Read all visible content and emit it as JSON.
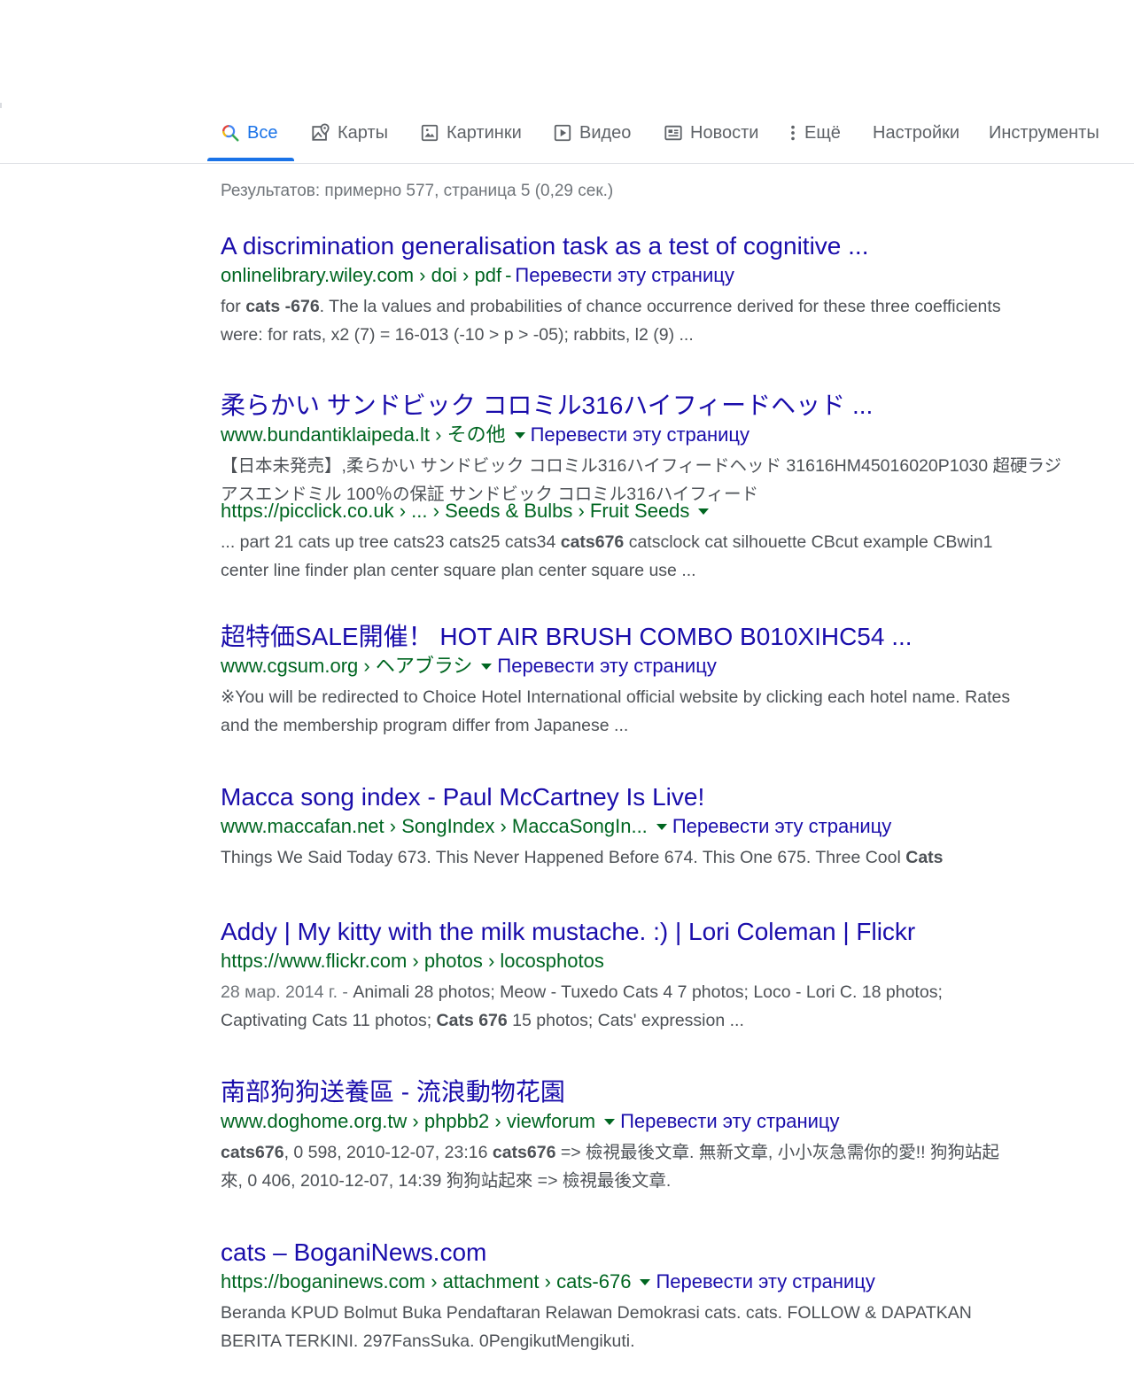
{
  "tabs": [
    {
      "label": "Все",
      "icon": "search-icon",
      "active": true
    },
    {
      "label": "Карты",
      "icon": "map-pin-icon"
    },
    {
      "label": "Картинки",
      "icon": "image-icon"
    },
    {
      "label": "Видео",
      "icon": "video-play-icon"
    },
    {
      "label": "Новости",
      "icon": "newspaper-icon"
    },
    {
      "label": "Ещё",
      "icon": "more-vert-icon"
    },
    {
      "label": "Настройки"
    },
    {
      "label": "Инструменты"
    }
  ],
  "stats": "Результатов: примерно 577, страница 5 (0,29 сек.)",
  "translate_label": "Перевести эту страницу",
  "colors": {
    "link": "#1a0dab",
    "url": "#006621",
    "active_tab": "#1a73e8"
  },
  "results": [
    {
      "title": "A discrimination generalisation task as a test of cognitive ...",
      "url": "onlinelibrary.wiley.com › doi › pdf",
      "snippet_parts": [
        "for ",
        "cats -676",
        ". The la values and probabilities of chance occurrence derived for these three coefficients were: for rats, x2 (7) = 16-013 (-10 > p > -05); rabbits, l2 (9) ..."
      ]
    },
    {
      "title": "柔らかい サンドビック コロミル316ハイフィードヘッド ...",
      "url": "www.bundantiklaipeda.lt › その他",
      "snippet_line1": "【日本未発売】,柔らかい サンドビック コロミル316ハイフィードヘッド 31616HM45016020P1030 超硬ラジ",
      "snippet_line2": "アスエンドミル 100％の保証 サンドビック コロミル316ハイフィード"
    },
    {
      "url": "https://picclick.co.uk › ... › Seeds & Bulbs › Fruit Seeds",
      "snippet_parts": [
        "... part 21 cats up tree cats23 cats25 cats34 ",
        "cats676",
        " catsclock cat silhouette CBcut example CBwin1 center line finder plan center square plan center square use ..."
      ]
    },
    {
      "title": "超特価SALE開催！ HOT AIR BRUSH COMBO B010XIHC54 ...",
      "url": "www.cgsum.org › ヘアブラシ",
      "snippet": "※You will be redirected to Choice Hotel International official website by clicking each hotel name. Rates and the membership program differ from Japanese ..."
    },
    {
      "title": "Macca song index - Paul McCartney Is Live!",
      "url": "www.maccafan.net › SongIndex › MaccaSongIn...",
      "snippet_parts": [
        "Things We Said Today 673. This Never Happened Before 674. This One 675. Three Cool ",
        "Cats"
      ]
    },
    {
      "title": "Addy | My kitty with the milk mustache. :) | Lori Coleman | Flickr",
      "url": "https://www.flickr.com › photos › locosphotos",
      "date": "28 мар. 2014 г. - ",
      "snippet_parts": [
        "Animali 28 photos; Meow - Tuxedo Cats 4 7 photos; Loco - Lori C. 18 photos; Captivating Cats 11 photos; ",
        "Cats 676",
        " 15 photos; Cats' expression ..."
      ]
    },
    {
      "title": "南部狗狗送養區 - 流浪動物花園",
      "url": "www.doghome.org.tw › phpbb2 › viewforum",
      "snippet_parts": [
        "cats676",
        ", 0 598, 2010-12-07, 23:16 ",
        "cats676",
        " => 檢視最後文章. 無新文章, 小小灰急需你的愛!! 狗狗站起來, 0 406, 2010-12-07, 14:39 狗狗站起來 => 檢視最後文章."
      ]
    },
    {
      "title": "cats – BoganiNews.com",
      "url": "https://boganinews.com › attachment › cats-676",
      "snippet": "Beranda KPUD Bolmut Buka Pendaftaran Relawan Demokrasi cats. cats. FOLLOW & DAPATKAN BERITA TERKINI. 297FansSuka. 0PengikutMengikuti."
    }
  ]
}
